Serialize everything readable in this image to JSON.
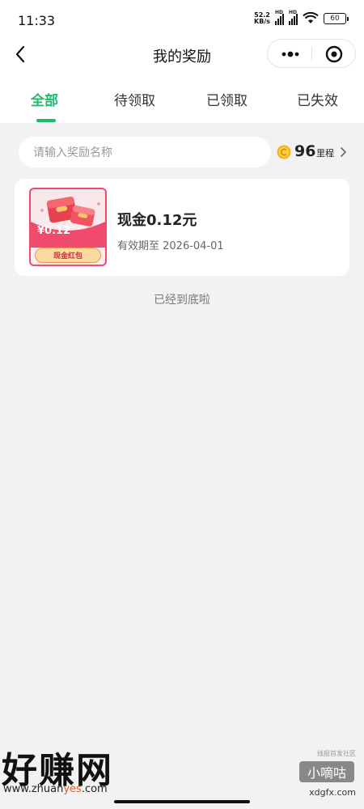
{
  "status_bar": {
    "time": "11:33",
    "net_speed_value": "52.2",
    "net_speed_unit": "KB/s",
    "hd_label": "HD",
    "battery": "60"
  },
  "nav": {
    "title": "我的奖励",
    "back_icon": "chevron-left-icon",
    "more_icon": "more-dots-icon",
    "close_icon": "target-icon"
  },
  "tabs": [
    {
      "label": "全部",
      "active": true
    },
    {
      "label": "待领取",
      "active": false
    },
    {
      "label": "已领取",
      "active": false
    },
    {
      "label": "已失效",
      "active": false
    }
  ],
  "search": {
    "placeholder": "请输入奖励名称"
  },
  "mileage": {
    "value": "96",
    "unit": "里程"
  },
  "rewards": [
    {
      "thumb_amount": "¥0.12",
      "thumb_label": "现金红包",
      "title": "现金0.12元",
      "validity": "有效期至 2026-04-01"
    }
  ],
  "end_text": "已经到底啦",
  "watermarks": {
    "left_big": "好赚网",
    "left_url_prefix": "www.zhuan",
    "left_url_highlight": "yes",
    "left_url_suffix": ".com",
    "right_top": "线报首发社区",
    "right_badge": "小嘀咕",
    "right_url": "xdgfx.com"
  },
  "colors": {
    "accent": "#1fba6a",
    "background": "#f2f2f2",
    "card": "#ffffff",
    "red_packet": "#f04b6c"
  }
}
